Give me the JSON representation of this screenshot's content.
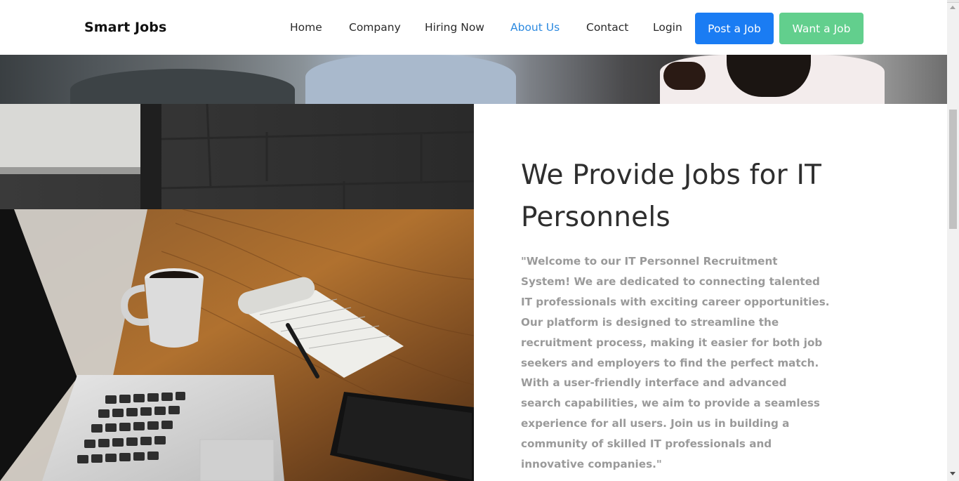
{
  "navbar": {
    "brand": "Smart Jobs",
    "links": {
      "home": "Home",
      "company": "Company",
      "hiring_now": "Hiring Now",
      "about_us": "About Us",
      "contact": "Contact",
      "login": "Login"
    },
    "active_link": "About Us",
    "post_job_label": "Post a Job",
    "want_job_label": "Want a Job"
  },
  "about": {
    "heading": "We Provide Jobs for IT Personnels",
    "paragraph": "\"Welcome to our IT Personnel Recruitment System! We are dedicated to connecting talented IT professionals with exciting career opportunities. Our platform is designed to streamline the recruitment process, making it easier for both job seekers and employers to find the perfect match. With a user-friendly interface and advanced search capabilities, we aim to provide a seamless experience for all users. Join us in building a community of skilled IT professionals and innovative companies.\""
  },
  "colors": {
    "accent_blue": "#1a7cf3",
    "accent_green": "#62cf8d",
    "active_link": "#2d8ae0"
  },
  "images": {
    "hero": "people-meeting-photo",
    "about": "desk-coffee-laptop-notepad-photo"
  }
}
